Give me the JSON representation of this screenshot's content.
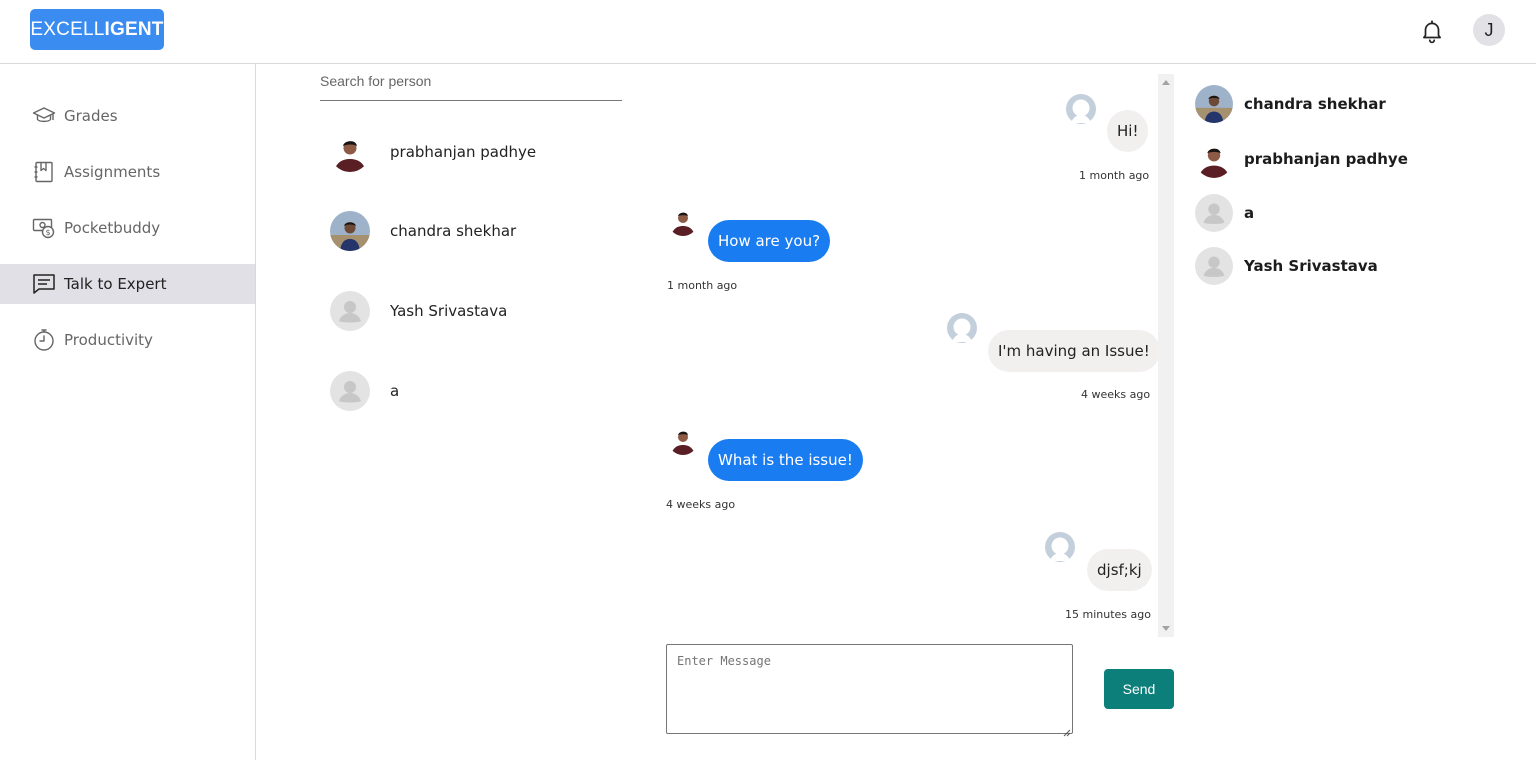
{
  "app": {
    "logo_light": "EXCELL",
    "logo_bold": "IGENT",
    "user_initial": "J",
    "brand_color": "#3b8cf0"
  },
  "header": {
    "notification_icon": "bell-icon"
  },
  "sidebar": {
    "items": [
      {
        "label": "Grades",
        "icon": "graduation-cap-icon",
        "active": false
      },
      {
        "label": "Assignments",
        "icon": "notebook-icon",
        "active": false
      },
      {
        "label": "Pocketbuddy",
        "icon": "money-icon",
        "active": false
      },
      {
        "label": "Talk to Expert",
        "icon": "chat-icon",
        "active": true
      },
      {
        "label": "Productivity",
        "icon": "stopwatch-icon",
        "active": false
      }
    ]
  },
  "contacts": {
    "search_placeholder": "Search for person",
    "list": [
      {
        "name": "prabhanjan padhye",
        "avatar": "photo"
      },
      {
        "name": "chandra shekhar",
        "avatar": "photo"
      },
      {
        "name": "Yash Srivastava",
        "avatar": "default"
      },
      {
        "name": "a",
        "avatar": "default"
      }
    ]
  },
  "chat": {
    "messages": [
      {
        "text": "Hi!",
        "time": "1 month ago",
        "from": "me"
      },
      {
        "text": "How are you?",
        "time": "1 month ago",
        "from": "expert"
      },
      {
        "text": "I'm having an Issue!",
        "time": "4 weeks ago",
        "from": "me"
      },
      {
        "text": "What is the issue!",
        "time": "4 weeks ago",
        "from": "expert"
      },
      {
        "text": "djsf;kj",
        "time": "15 minutes ago",
        "from": "me"
      }
    ],
    "composer_placeholder": "Enter Message",
    "send_label": "Send",
    "send_color": "#0d7f7b",
    "outgoing_bubble_color": "#1a7cf1",
    "incoming_bubble_color": "#f2efef"
  },
  "online_panel": {
    "list": [
      {
        "name": "chandra shekhar",
        "avatar": "photo"
      },
      {
        "name": "prabhanjan padhye",
        "avatar": "photo"
      },
      {
        "name": "a",
        "avatar": "default"
      },
      {
        "name": "Yash Srivastava",
        "avatar": "default"
      }
    ]
  }
}
